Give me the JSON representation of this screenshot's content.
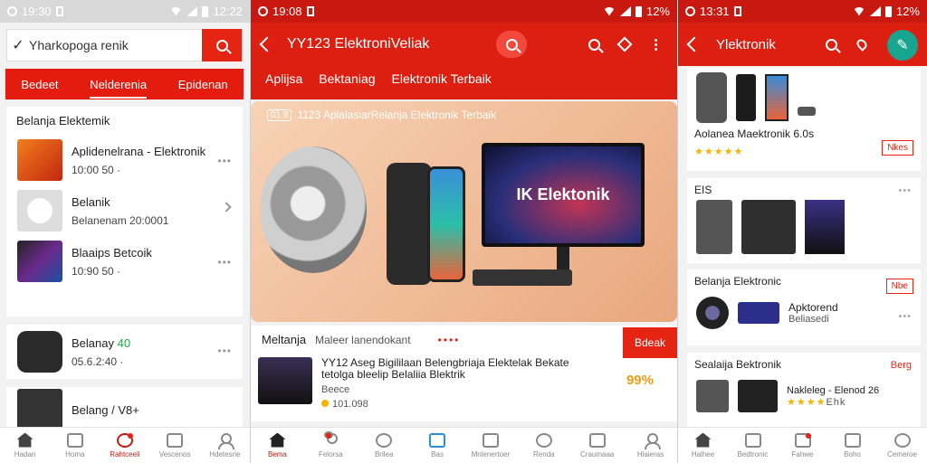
{
  "screen1": {
    "status_time": "19:30",
    "status_battery": "12:22",
    "search_value": "Yharkopoga renik",
    "tabs": [
      "Bedeet",
      "Nelderenia",
      "Epidenan"
    ],
    "section_title": "Belanja Elektemik",
    "items": [
      {
        "title": "Aplidenelrana - Elektronik",
        "sub": "10:00 50 ·"
      },
      {
        "title": "Belanik",
        "sub": "Belanenam 20:0001"
      },
      {
        "title": "Blaaips Betcoik",
        "sub": "10:90 50 ·"
      }
    ],
    "card2": {
      "title": "Belanay",
      "badge": "40",
      "sub": "05.6.2:40 ·"
    },
    "card3": {
      "title": "Belang /",
      "sub": "V8+"
    },
    "nav": [
      "Hadan",
      "Homa",
      "Rahtceeli",
      "Vescenos",
      "Hdetesrie"
    ]
  },
  "screen2": {
    "status_time": "19:08",
    "status_battery": "12%",
    "title": "YY123 ElektroniVeliak",
    "tabs": [
      "Aplijsa",
      "Bektaniag",
      "Elektronik Terbaik"
    ],
    "banner_chip": "01 8",
    "banner_text": "1123 AplalasiarRelanja Elektronik Terbaik",
    "monitor_text": "IK Elektonik",
    "bundle_head": "Meltanja",
    "bundle_sub": "Maleer lanendokant",
    "bundle_button": "Bdeak",
    "bundle_desc": "YY12 Aseg Bigililaan Belengbriaja Elektelak Bekate tetolga bleelip Belaliia Blektrik",
    "bundle_extra": "Beece",
    "bundle_price": "101.098",
    "bundle_pct": "99%",
    "nav": [
      "Bema",
      "Felorsa",
      "Brilea",
      "Bas",
      "Mnlenertoer",
      "Renda",
      "Craumaaa",
      "Hlaieras"
    ]
  },
  "screen3": {
    "status_time": "13:31",
    "status_battery": "12%",
    "title": "Ylektronik",
    "card1": {
      "title": "Aolanea Maektronik 6.0s",
      "button": "Nkes"
    },
    "card2": {
      "tag": "EIS"
    },
    "card3": {
      "title": "Belanja Elektronic",
      "item": "Apktorend",
      "sub": "Beliasedi",
      "button": "Nbe"
    },
    "card4": {
      "title": "Sealaija Bektronik",
      "tag": "Berg",
      "item": "Nakleleg - Elenod 26",
      "sub": "Ehk"
    },
    "nav": [
      "Halhee",
      "Bedtronic",
      "Fahwe",
      "Boho",
      "Cemeroe"
    ]
  }
}
